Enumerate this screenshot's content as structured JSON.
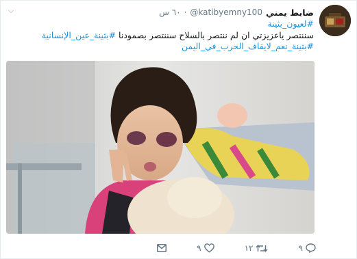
{
  "tweet": {
    "display_name": "ضابط يمني",
    "handle": "@katibyemny100",
    "separator": "·",
    "time": "٦٠ س",
    "lines": [
      {
        "segments": [
          {
            "text": "#لعيون_بثينة",
            "hashtag": true
          }
        ]
      },
      {
        "segments": [
          {
            "text": "سننتصر ياعزيزتي ان لم ننتصر بالسلاح سننتصر بصمودنا ",
            "hashtag": false
          },
          {
            "text": "#بثينة_عين_الإنسانية",
            "hashtag": true
          }
        ]
      },
      {
        "segments": [
          {
            "text": "#بثينة_نعم_لايقاف_الحرب_في_اليمن",
            "hashtag": true
          }
        ]
      }
    ],
    "photo_alt": "",
    "icons": {
      "caret": "chevron-down-icon",
      "reply": "reply-icon",
      "retweet": "retweet-icon",
      "like": "heart-icon",
      "dm": "envelope-icon"
    },
    "actions": {
      "reply_count": "٩",
      "retweet_count": "١٢",
      "like_count": "٩"
    }
  },
  "colors": {
    "link": "#1b95e0",
    "text": "#14171a",
    "secondary": "#657786",
    "border": "#e6ecf0"
  }
}
